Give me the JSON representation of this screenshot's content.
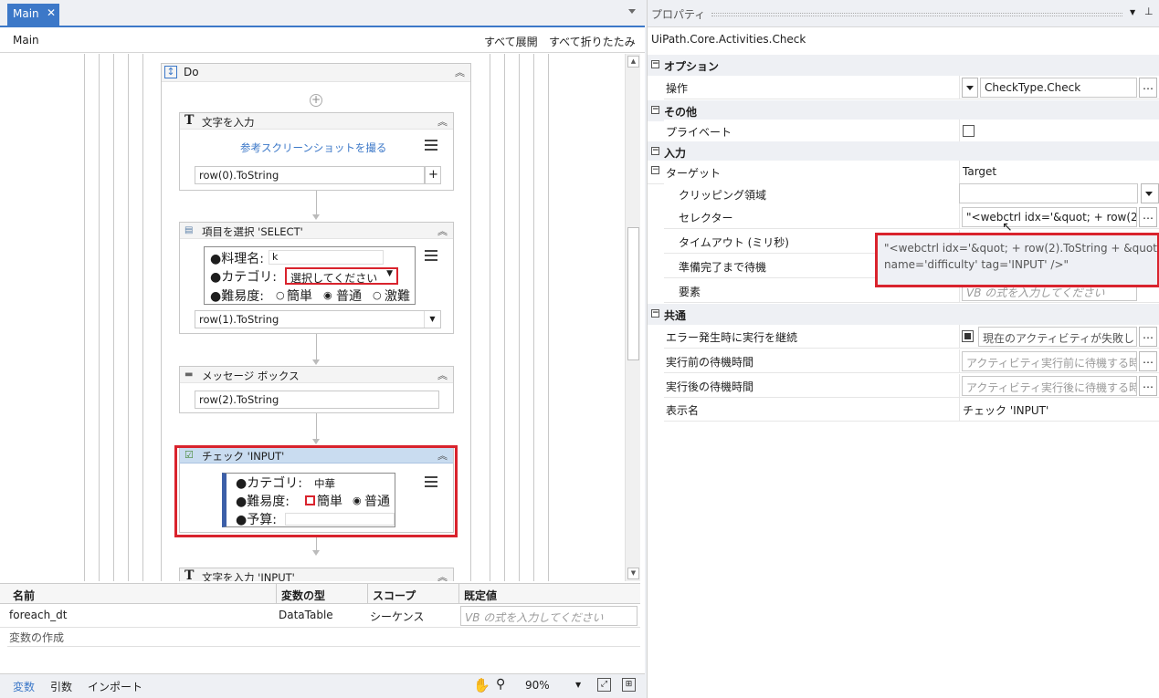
{
  "designer": {
    "tab_label": "Main",
    "tab_close": "✕",
    "breadcrumb": "Main",
    "expand_all": "すべて展開",
    "collapse_all": "すべて折りたたみ",
    "do_title": "Do",
    "type_into_1": {
      "title": "文字を入力",
      "link": "参考スクリーンショットを撮る",
      "value": "row(0).ToString",
      "plus": "+"
    },
    "select_item": {
      "title": "項目を選択 'SELECT'",
      "row1_label": "●料理名:",
      "row1_value": "k",
      "row2_label": "●カテゴリ:",
      "row2_select": "選択してください",
      "row3_label": "●難易度:",
      "opt_easy": "簡単",
      "opt_normal": "普通",
      "opt_hard": "激難",
      "value": "row(1).ToString"
    },
    "message_box": {
      "title": "メッセージ ボックス",
      "value": "row(2).ToString"
    },
    "check": {
      "title": "チェック 'INPUT'",
      "row1_label": "●カテゴリ:",
      "row1_value": "中華",
      "row2_label": "●難易度:",
      "opt_easy": "簡単",
      "opt_normal": "普通",
      "row3_label": "●予算:"
    },
    "type_into_2": {
      "title": "文字を入力 'INPUT'"
    }
  },
  "variables": {
    "headers": [
      "名前",
      "変数の型",
      "スコープ",
      "既定値"
    ],
    "rows": [
      {
        "name": "foreach_dt",
        "type": "DataTable",
        "scope": "シーケンス",
        "default_placeholder": "VB の式を入力してください"
      }
    ],
    "create_label": "変数の作成"
  },
  "statusbar": {
    "tab_vars": "変数",
    "tab_args": "引数",
    "tab_imports": "インポート",
    "zoom": "90%"
  },
  "properties": {
    "panel_title": "プロパティ",
    "type_name": "UiPath.Core.Activities.Check",
    "cat_options": "オプション",
    "op_label": "操作",
    "op_value": "CheckType.Check",
    "cat_misc": "その他",
    "private_label": "プライベート",
    "cat_input": "入力",
    "target_label": "ターゲット",
    "target_value": "Target",
    "clipping_label": "クリッピング領域",
    "selector_label": "セレクター",
    "selector_value": "\"<webctrl idx='&quot; + row(2",
    "timeout_label": "タイムアウト (ミリ秒)",
    "wait_label": "準備完了まで待機",
    "element_label": "要素",
    "element_placeholder": "VB の式を入力してください",
    "cat_common": "共通",
    "continue_label": "エラー発生時に実行を継続",
    "continue_value": "現在のアクティビティが失敗し",
    "delay_before_label": "実行前の待機時間",
    "delay_before_placeholder": "アクティビティ実行前に待機する時",
    "delay_after_label": "実行後の待機時間",
    "delay_after_placeholder": "アクティビティ実行後に待機する時",
    "display_label": "表示名",
    "display_value": "チェック 'INPUT'",
    "tooltip_line1": "\"<webctrl idx='&quot; + row(2).ToString + &quot;",
    "tooltip_line2": "name='difficulty' tag='INPUT' />\""
  },
  "colors": {
    "accent": "#3c78c8",
    "highlight": "#d9232d",
    "selected_header": "#c9dcf0"
  }
}
